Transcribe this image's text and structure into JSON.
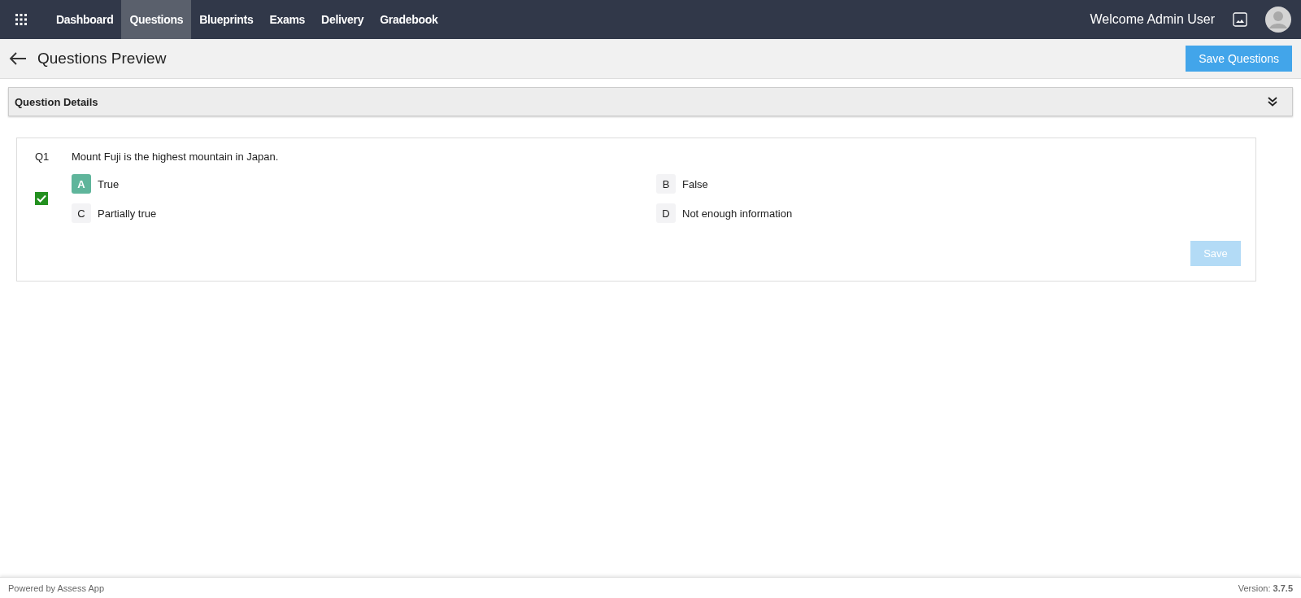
{
  "nav": {
    "items": [
      {
        "label": "Dashboard",
        "selected": false
      },
      {
        "label": "Questions",
        "selected": true
      },
      {
        "label": "Blueprints",
        "selected": false
      },
      {
        "label": "Exams",
        "selected": false
      },
      {
        "label": "Delivery",
        "selected": false
      },
      {
        "label": "Gradebook",
        "selected": false
      }
    ],
    "welcome": "Welcome Admin User"
  },
  "header": {
    "title": "Questions Preview",
    "save_button": "Save Questions"
  },
  "details": {
    "title": "Question Details",
    "expanded": false
  },
  "questions": [
    {
      "number": "Q1",
      "text": "Mount Fuji is the highest mountain in Japan.",
      "checked": true,
      "options": [
        {
          "letter": "A",
          "label": "True",
          "selected": true
        },
        {
          "letter": "B",
          "label": "False",
          "selected": false
        },
        {
          "letter": "C",
          "label": "Partially true",
          "selected": false
        },
        {
          "letter": "D",
          "label": "Not enough information",
          "selected": false
        }
      ],
      "save_button": {
        "label": "Save",
        "disabled": true
      }
    }
  ],
  "footer": {
    "left": "Powered by Assess App",
    "version": "Version: **3.7.5**"
  }
}
